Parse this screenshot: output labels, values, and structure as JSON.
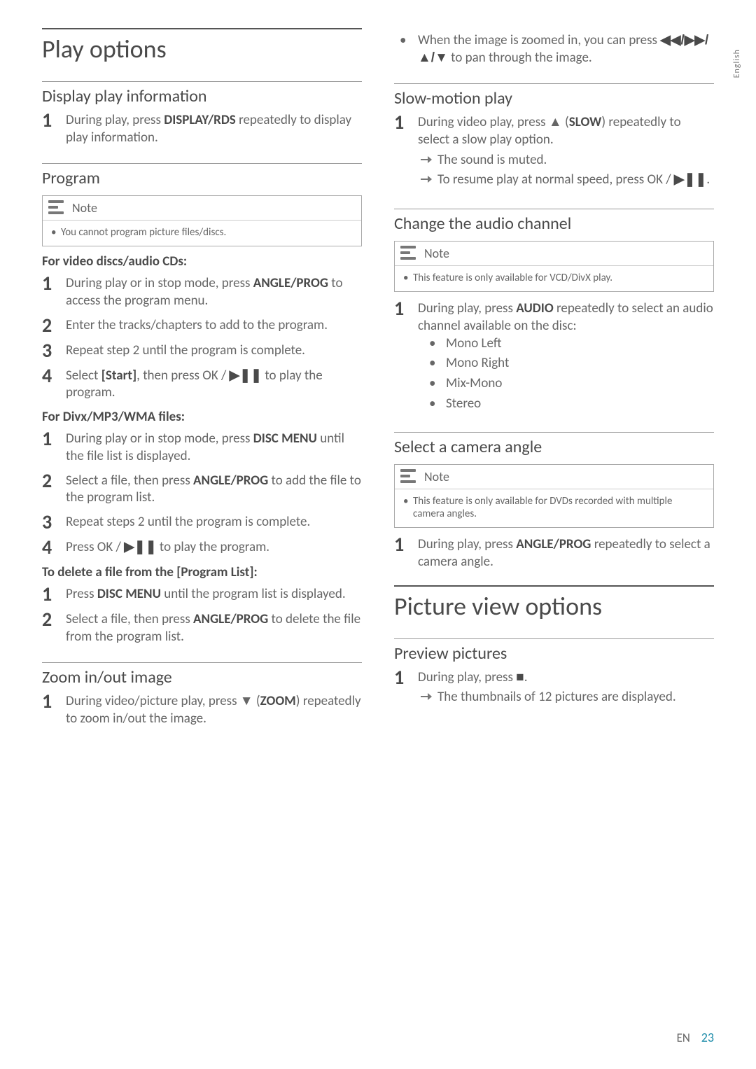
{
  "side_tab": "English",
  "footer": {
    "lang": "EN",
    "page": "23"
  },
  "left": {
    "h1": "Play options",
    "sec1": {
      "title": "Display play information",
      "step1_a": "During play, press ",
      "step1_b": "DISPLAY/RDS",
      "step1_c": " repeatedly to display play information."
    },
    "sec2": {
      "title": "Program",
      "note_label": "Note",
      "note_item": "You cannot program picture files/discs.",
      "sub1": "For video discs/audio CDs:",
      "s1_a": "During play or in stop mode, press ",
      "s1_b": "ANGLE/PROG",
      "s1_c": " to access the program menu.",
      "s2": "Enter the tracks/chapters to add to the program.",
      "s3": "Repeat step 2 until the program is complete.",
      "s4_a": "Select ",
      "s4_b": "[Start]",
      "s4_c": ", then press OK / ",
      "s4_d": "▶❚❚",
      "s4_e": " to play the program.",
      "sub2": "For Divx/MP3/WMA files:",
      "d1_a": "During play or in stop mode, press ",
      "d1_b": "DISC MENU",
      "d1_c": " until the file list is displayed.",
      "d2_a": "Select a file, then press ",
      "d2_b": "ANGLE/PROG",
      "d2_c": " to add the file to the program list.",
      "d3": "Repeat steps 2 until the program is complete.",
      "d4_a": "Press OK / ",
      "d4_b": "▶❚❚",
      "d4_c": " to play the program.",
      "sub3": "To delete a file from the [Program List]:",
      "p1_a": "Press ",
      "p1_b": "DISC MENU",
      "p1_c": " until the program list is displayed.",
      "p2_a": "Select a file, then press ",
      "p2_b": "ANGLE/PROG",
      "p2_c": " to delete the file from the program list."
    },
    "sec3": {
      "title": "Zoom in/out image",
      "s1_a": "During video/picture play, press ▼ (",
      "s1_b": "ZOOM",
      "s1_c": ") repeatedly to zoom in/out the image."
    }
  },
  "right": {
    "top_bullet_a": "When the image is zoomed in, you can press ",
    "top_bullet_b": "◀◀/▶▶/▲/▼",
    "top_bullet_c": " to pan through the image.",
    "sec1": {
      "title": "Slow-motion play",
      "s1_a": "During video play, press ▲ (",
      "s1_b": "SLOW",
      "s1_c": ") repeatedly to select a slow play option.",
      "sub1": "The sound is muted.",
      "sub2_a": "To resume play at normal speed, press OK / ",
      "sub2_b": "▶❚❚",
      "sub2_c": "."
    },
    "sec2": {
      "title": "Change the audio channel",
      "note_label": "Note",
      "note_item": "This feature is only available for VCD/DivX play.",
      "s1_a": "During play, press ",
      "s1_b": "AUDIO",
      "s1_c": " repeatedly to select an audio channel available on the disc:",
      "opt1": "Mono Left",
      "opt2": "Mono Right",
      "opt3": "Mix-Mono",
      "opt4": "Stereo"
    },
    "sec3": {
      "title": "Select a camera angle",
      "note_label": "Note",
      "note_item": "This feature is only available for DVDs recorded with multiple camera angles.",
      "s1_a": "During play, press ",
      "s1_b": "ANGLE/PROG",
      "s1_c": " repeatedly to select a camera angle."
    },
    "h1b": "Picture view options",
    "sec4": {
      "title": "Preview pictures",
      "s1_a": "During play, press ",
      "s1_b": "■",
      "s1_c": ".",
      "sub1": "The thumbnails of 12 pictures are displayed."
    }
  }
}
